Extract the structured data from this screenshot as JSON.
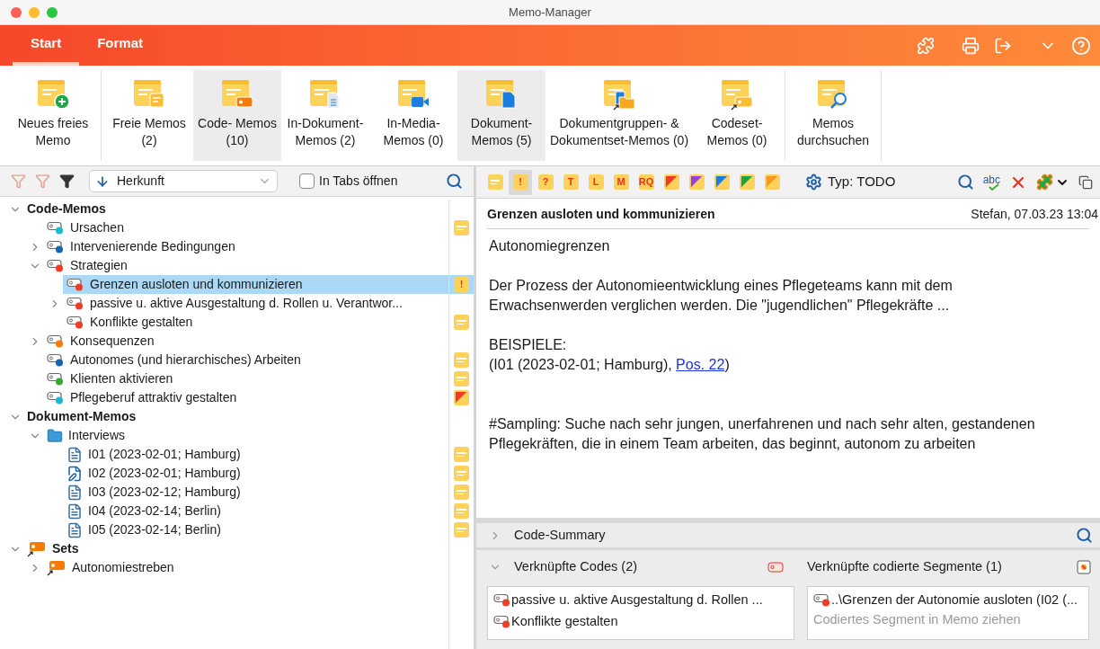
{
  "window": {
    "title": "Memo-Manager"
  },
  "ribbon": {
    "tabs": [
      {
        "label": "Start",
        "selected": true
      },
      {
        "label": "Format",
        "selected": false
      }
    ],
    "groups": [
      {
        "buttons": [
          {
            "kind": "new",
            "lines": [
              "Neues freies",
              "Memo"
            ],
            "selected": false
          }
        ]
      },
      {
        "buttons": [
          {
            "kind": "free",
            "lines": [
              "Freie Memos",
              "(2)"
            ],
            "selected": false
          },
          {
            "kind": "code",
            "lines": [
              "Code- Memos",
              "(10)"
            ],
            "selected": true
          },
          {
            "kind": "in-document",
            "lines": [
              "In-Dokument-",
              "Memos (2)"
            ],
            "selected": false
          },
          {
            "kind": "media",
            "lines": [
              "In-Media-",
              "Memos (0)"
            ],
            "selected": false
          },
          {
            "kind": "document",
            "lines": [
              "Dokument-",
              "Memos (5)"
            ],
            "selected": true
          },
          {
            "kind": "docgroup",
            "lines": [
              "Dokumentgruppen- &",
              "Dokumentset-Memos (0)"
            ],
            "selected": false
          },
          {
            "kind": "codeset",
            "lines": [
              "Codeset-",
              "Memos (0)"
            ],
            "selected": false
          }
        ]
      },
      {
        "buttons": [
          {
            "kind": "search",
            "lines": [
              "Memos",
              "durchsuchen"
            ],
            "selected": false
          }
        ]
      }
    ]
  },
  "list_toolbar": {
    "sort": "Herkunft",
    "tabs_checkbox": {
      "label": "In Tabs öffnen",
      "checked": false
    }
  },
  "tree": [
    {
      "kind": "group",
      "label": "Code-Memos",
      "expanded": true,
      "selected": false,
      "children": [
        {
          "kind": "code",
          "label": "Ursachen",
          "color": "#1bb8cf",
          "selected": false,
          "memo": {
            "kind": "plain"
          }
        },
        {
          "kind": "code",
          "label": "Intervenierende Bedingungen",
          "color": "#1565b0",
          "expanded": false,
          "selected": false
        },
        {
          "kind": "code",
          "label": "Strategien",
          "color": "#f03c24",
          "expanded": true,
          "selected": false,
          "children": [
            {
              "kind": "code",
              "label": "Grenzen ausloten und kommunizieren",
              "color": "#f03c24",
              "selected": true,
              "memo": {
                "kind": "symbol",
                "symbol": "!"
              }
            },
            {
              "kind": "code",
              "label": "passive u. aktive Ausgestaltung d. Rollen u. Verantwor...",
              "color": "#f03c24",
              "expanded": false,
              "selected": false
            },
            {
              "kind": "code",
              "label": "Konflikte gestalten",
              "color": "#f03c24",
              "selected": false,
              "memo": {
                "kind": "plain"
              }
            }
          ]
        },
        {
          "kind": "code",
          "label": "Konsequenzen",
          "color": "#f57c00",
          "expanded": false,
          "selected": false
        },
        {
          "kind": "code",
          "label": "Autonomes (und hierarchisches) Arbeiten",
          "color": "#1565b0",
          "selected": false,
          "memo": {
            "kind": "plain"
          }
        },
        {
          "kind": "code",
          "label": "Klienten aktivieren",
          "color": "#3aa830",
          "selected": false,
          "memo": {
            "kind": "plain"
          }
        },
        {
          "kind": "code",
          "label": "Pflegeberuf attraktiv gestalten",
          "color": "#1bb8cf",
          "selected": false,
          "memo": {
            "kind": "corner",
            "color": "#f03c24"
          }
        }
      ]
    },
    {
      "kind": "group",
      "label": "Dokument-Memos",
      "expanded": true,
      "selected": false,
      "children": [
        {
          "kind": "folder",
          "label": "Interviews",
          "expanded": true,
          "selected": false,
          "children": [
            {
              "kind": "document",
              "label": "I01 (2023-02-01; Hamburg)",
              "selected": false,
              "memo": {
                "kind": "plain"
              }
            },
            {
              "kind": "edited-document",
              "label": "I02 (2023-02-01; Hamburg)",
              "selected": false,
              "memo": {
                "kind": "plain"
              }
            },
            {
              "kind": "document",
              "label": "I03 (2023-02-12; Hamburg)",
              "selected": false,
              "memo": {
                "kind": "plain"
              }
            },
            {
              "kind": "document",
              "label": "I04 (2023-02-14; Berlin)",
              "selected": false,
              "memo": {
                "kind": "plain"
              }
            },
            {
              "kind": "document",
              "label": "I05 (2023-02-14; Berlin)",
              "selected": false,
              "memo": {
                "kind": "plain"
              }
            }
          ]
        }
      ]
    },
    {
      "kind": "set-group",
      "label": "Sets",
      "expanded": true,
      "selected": false,
      "children": [
        {
          "kind": "set",
          "label": "Autonomiestreben",
          "expanded": false,
          "selected": false
        }
      ]
    }
  ],
  "memo_types": [
    {
      "kind": "plain",
      "selected": false
    },
    {
      "kind": "symbol",
      "symbol": "!",
      "selected": true
    },
    {
      "kind": "symbol",
      "symbol": "?",
      "selected": false
    },
    {
      "kind": "symbol",
      "symbol": "T",
      "selected": false
    },
    {
      "kind": "symbol",
      "symbol": "L",
      "selected": false
    },
    {
      "kind": "symbol",
      "symbol": "M",
      "selected": false
    },
    {
      "kind": "symbol",
      "symbol": "RQ",
      "selected": false
    },
    {
      "kind": "corner",
      "color": "#f03c24",
      "selected": false
    },
    {
      "kind": "corner",
      "color": "#9c3fd6",
      "selected": false
    },
    {
      "kind": "corner",
      "color": "#1a7de0",
      "selected": false
    },
    {
      "kind": "corner",
      "color": "#1fa040",
      "selected": false
    },
    {
      "kind": "corner",
      "color": "#f59a1c",
      "selected": false
    }
  ],
  "memo_type_label": "Typ: TODO",
  "spellcheck_label": "abc",
  "memo": {
    "title": "Grenzen ausloten und kommunizieren",
    "meta": "Stefan, 07.03.23 13:04",
    "body": [
      {
        "kind": "text",
        "text": "Autonomiegrenzen"
      },
      {
        "kind": "text",
        "text": "Der Prozess der Autonomieentwicklung eines Pflegeteams kann mit dem Erwachsenwerden verglichen werden. Die \"jugendlichen\" Pflegekräfte ..."
      },
      {
        "kind": "reference",
        "heading": "BEISPIELE:",
        "before": "(I01 (2023-02-01; Hamburg), ",
        "link": "Pos. 22",
        "after": ")"
      },
      {
        "kind": "text",
        "text": "#Sampling: Suche nach sehr jungen, unerfahrenen und nach sehr alten, gestandenen Pflegekräften, die in einem Team arbeiten, das beginnt, autonom zu arbeiten"
      }
    ]
  },
  "code_summary": {
    "label": "Code-Summary",
    "expanded": false
  },
  "linked": {
    "expanded": true,
    "codes": {
      "label": "Verknüpfte Codes (2)",
      "items": [
        {
          "label": "passive u. aktive Ausgestaltung d. Rollen ...",
          "color": "#f03c24"
        },
        {
          "label": "Konflikte gestalten",
          "color": "#f03c24"
        }
      ]
    },
    "segments": {
      "label": "Verknüpfte codierte Segmente (1)",
      "items": [
        {
          "label": "..\\Grenzen der Autonomie ausloten (I02 (...",
          "color": "#f03c24"
        }
      ],
      "placeholder": "Codiertes Segment in Memo ziehen"
    }
  }
}
